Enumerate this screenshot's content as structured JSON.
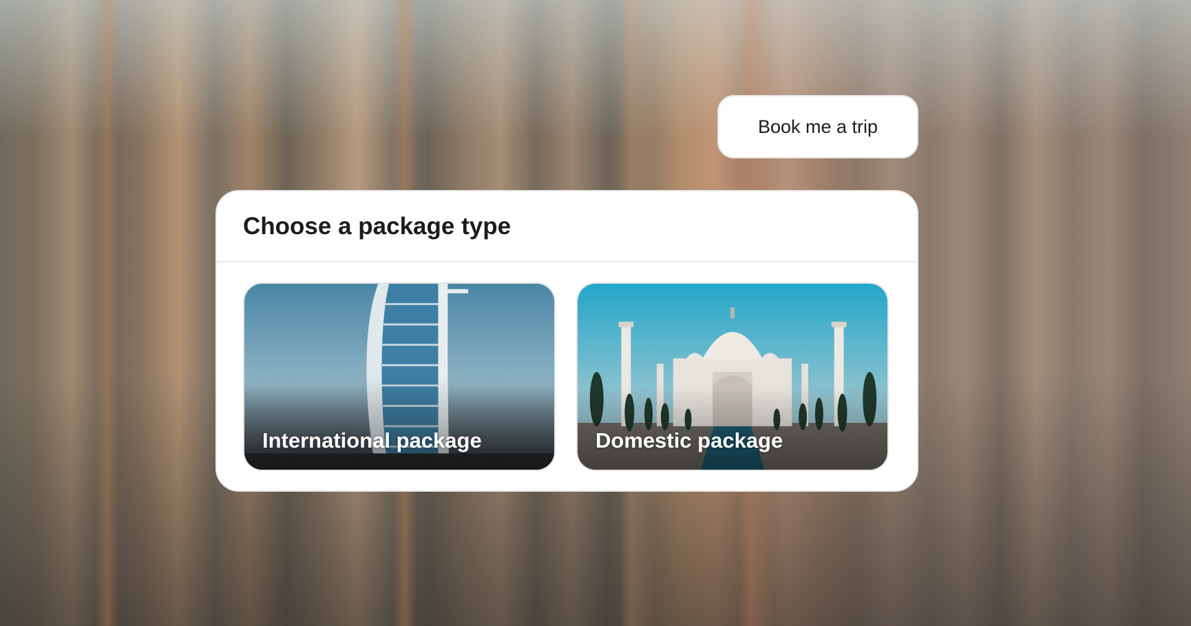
{
  "chat": {
    "user_message": "Book me a trip"
  },
  "package_picker": {
    "title": "Choose a package type",
    "options": [
      {
        "label": "International package",
        "image": "burj-al-arab-hotel"
      },
      {
        "label": "Domestic package",
        "image": "taj-mahal"
      }
    ]
  },
  "colors": {
    "card_background": "#ffffff",
    "title_text": "#1c1c1e",
    "sky_international": "#4f8aa8",
    "sky_domestic": "#2aa7c8"
  }
}
